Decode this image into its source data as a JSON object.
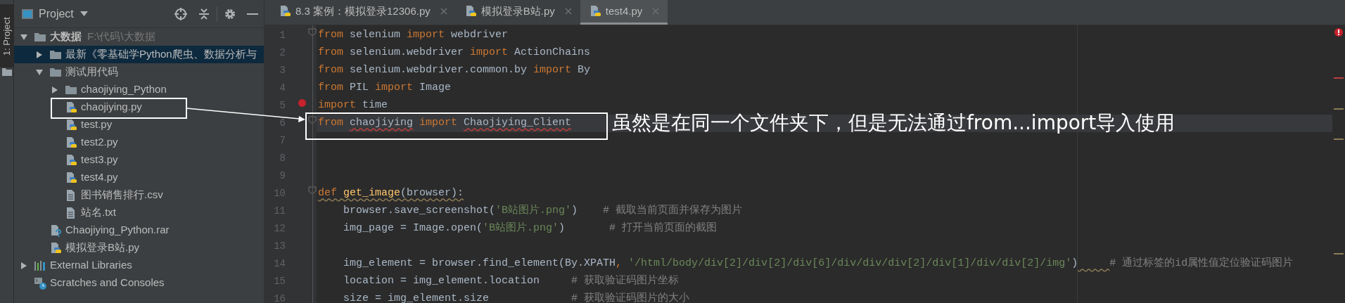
{
  "tool_stripe": [
    {
      "label": "1: Project",
      "selected": true
    }
  ],
  "project_panel": {
    "title": "Project",
    "tree": [
      {
        "label": "大数据",
        "note": "F:\\代码\\大数据",
        "kind": "root",
        "expanded": true,
        "selected": false,
        "children": [
          {
            "label": "最新《零基础学Python爬虫、数据分析与",
            "kind": "folder",
            "expanded": false,
            "selected": true
          },
          {
            "label": "测试用代码",
            "kind": "folder",
            "expanded": true,
            "selected": false,
            "children": [
              {
                "label": "chaojiying_Python",
                "kind": "folder",
                "expanded": false,
                "selected": false
              },
              {
                "label": "chaojiying.py",
                "kind": "python",
                "selected": false
              },
              {
                "label": "test.py",
                "kind": "python",
                "selected": false
              },
              {
                "label": "test2.py",
                "kind": "python",
                "selected": false
              },
              {
                "label": "test3.py",
                "kind": "python",
                "selected": false
              },
              {
                "label": "test4.py",
                "kind": "python",
                "selected": false
              },
              {
                "label": "图书销售排行.csv",
                "kind": "text",
                "selected": false
              },
              {
                "label": "站名.txt",
                "kind": "text",
                "selected": false
              }
            ]
          },
          {
            "label": "Chaojiying_Python.rar",
            "kind": "unknown",
            "selected": false
          },
          {
            "label": "模拟登录B站.py",
            "kind": "python",
            "selected": false
          }
        ]
      },
      {
        "label": "External Libraries",
        "kind": "library",
        "expanded": false,
        "selected": false
      },
      {
        "label": "Scratches and Consoles",
        "kind": "scratches",
        "selected": false
      }
    ]
  },
  "tabs": [
    {
      "label": "8.3 案例：模拟登录12306.py",
      "selected": false
    },
    {
      "label": "模拟登录B站.py",
      "selected": false
    },
    {
      "label": "test4.py",
      "selected": true
    }
  ],
  "editor": {
    "lines": [
      {
        "number": "1",
        "fold": true,
        "tokens": [
          {
            "kind": "keyword",
            "text": "from"
          },
          {
            "kind": "plain",
            "text": " selenium "
          },
          {
            "kind": "keyword",
            "text": "import"
          },
          {
            "kind": "plain",
            "text": " webdriver"
          }
        ]
      },
      {
        "number": "2",
        "tokens": [
          {
            "kind": "keyword",
            "text": "from"
          },
          {
            "kind": "plain",
            "text": " selenium.webdriver "
          },
          {
            "kind": "keyword",
            "text": "import"
          },
          {
            "kind": "plain",
            "text": " ActionChains"
          }
        ]
      },
      {
        "number": "3",
        "tokens": [
          {
            "kind": "keyword",
            "text": "from"
          },
          {
            "kind": "plain",
            "text": " selenium.webdriver.common.by "
          },
          {
            "kind": "keyword",
            "text": "import"
          },
          {
            "kind": "plain",
            "text": " By"
          }
        ]
      },
      {
        "number": "4",
        "tokens": [
          {
            "kind": "keyword",
            "text": "from"
          },
          {
            "kind": "plain",
            "text": " PIL "
          },
          {
            "kind": "keyword",
            "text": "import"
          },
          {
            "kind": "plain",
            "text": " Image"
          }
        ]
      },
      {
        "number": "5",
        "error_bulb": true,
        "tokens": [
          {
            "kind": "keyword",
            "text": "import"
          },
          {
            "kind": "plain",
            "text": " time"
          }
        ]
      },
      {
        "number": "6",
        "fold": true,
        "current": true,
        "tokens": [
          {
            "kind": "keyword",
            "text": "from "
          },
          {
            "kind": "plain",
            "text": "chaojiying",
            "error_underline": true
          },
          {
            "kind": "keyword",
            "text": " import "
          },
          {
            "kind": "plain",
            "text": "Chaojiying_Client",
            "error_underline": true
          }
        ]
      },
      {
        "number": "7"
      },
      {
        "number": "8"
      },
      {
        "number": "9"
      },
      {
        "number": "10",
        "fold": true,
        "tokens": [
          {
            "kind": "keyword",
            "text": "def ",
            "warning_underline": true
          },
          {
            "kind": "function",
            "text": "get_image",
            "warning_underline": true
          },
          {
            "kind": "plain",
            "text": "(browser):",
            "warning_underline": true
          }
        ]
      },
      {
        "number": "11",
        "tokens": [
          {
            "kind": "plain",
            "text": "    browser.save_screenshot("
          },
          {
            "kind": "string",
            "text": "'B站图片.png'"
          },
          {
            "kind": "plain",
            "text": ")    "
          },
          {
            "kind": "comment",
            "text": "# 截取当前页面并保存为图片"
          }
        ]
      },
      {
        "number": "12",
        "tokens": [
          {
            "kind": "plain",
            "text": "    img_page = Image.open("
          },
          {
            "kind": "string",
            "text": "'B站图片.png'"
          },
          {
            "kind": "plain",
            "text": ")       "
          },
          {
            "kind": "comment",
            "text": "# 打开当前页面的截图"
          }
        ]
      },
      {
        "number": "13"
      },
      {
        "number": "14",
        "tokens": [
          {
            "kind": "plain",
            "text": "    img_element = browser.find_element(By.XPATH"
          },
          {
            "kind": "keyword",
            "text": ", "
          },
          {
            "kind": "string",
            "text": "'/html/body/div[2]/div[2]/div[6]/div/div/div[2]/div[1]/div/div[2]/img'"
          },
          {
            "kind": "plain",
            "text": ")",
            "trailing_warning_underline": true
          },
          {
            "kind": "comment",
            "text": "# 通过标签的id属性值定位验证码图片"
          }
        ]
      },
      {
        "number": "15",
        "tokens": [
          {
            "kind": "plain",
            "text": "    location = img_element.location     "
          },
          {
            "kind": "comment",
            "text": "# 获取验证码图片坐标"
          }
        ]
      },
      {
        "number": "16",
        "tokens": [
          {
            "kind": "plain",
            "text": "    size = img_element.size             "
          },
          {
            "kind": "comment",
            "text": "# 获取验证码图片的大小"
          }
        ]
      }
    ]
  },
  "annotation": {
    "text": "虽然是在同一个文件夹下，但是无法通过from...import导入使用"
  }
}
